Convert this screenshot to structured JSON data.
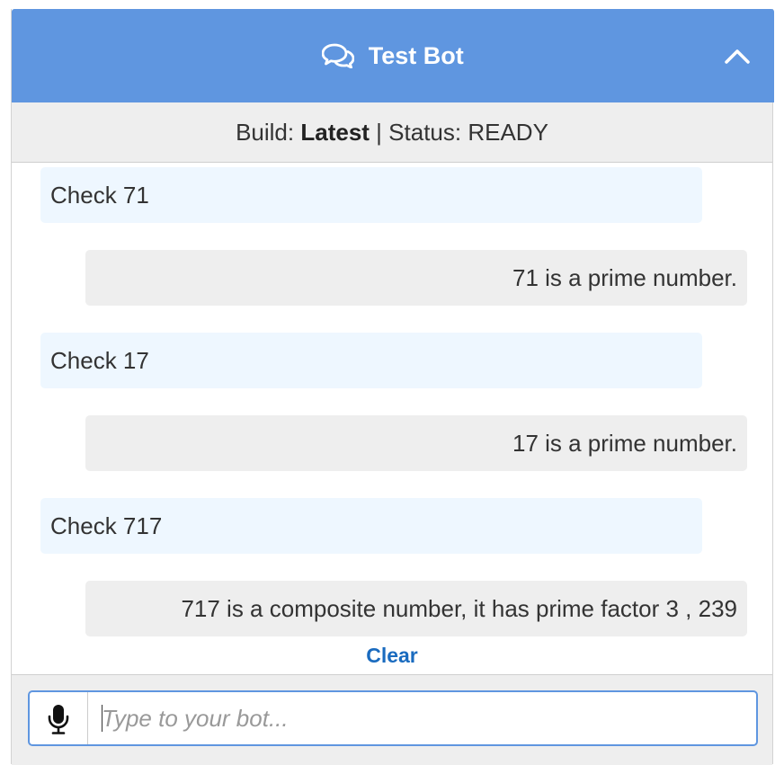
{
  "header": {
    "title": "Test Bot",
    "icon": "chat-bubbles-icon",
    "collapse_icon": "chevron-up-icon",
    "color": "#5f96e0"
  },
  "status": {
    "build_label": "Build:",
    "build_value": "Latest",
    "separator": "|",
    "status_label": "Status:",
    "status_value": "READY"
  },
  "messages": [
    {
      "role": "user",
      "text": "Check 71"
    },
    {
      "role": "bot",
      "text": "71 is a prime number."
    },
    {
      "role": "user",
      "text": "Check 17"
    },
    {
      "role": "bot",
      "text": "17 is a prime number."
    },
    {
      "role": "user",
      "text": "Check 717"
    },
    {
      "role": "bot",
      "text": "717 is a composite number, it has prime factor 3 , 239"
    }
  ],
  "actions": {
    "clear_label": "Clear"
  },
  "input": {
    "placeholder": "Type to your bot...",
    "value": "",
    "mic_icon": "microphone-icon"
  }
}
